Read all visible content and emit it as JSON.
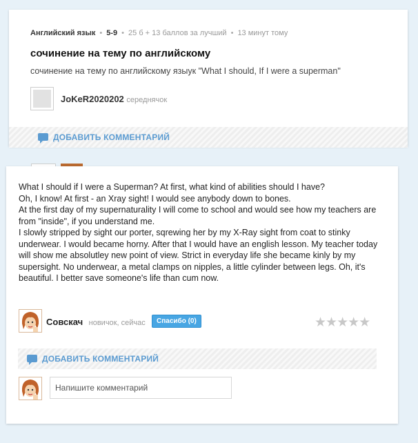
{
  "question": {
    "subject": "Английский язык",
    "grade": "5-9",
    "points": "25 б + 13 баллов за лучший",
    "time": "13 минут тому",
    "title": "сочинение на тему по английскому",
    "text": "сочинение на тему по английскому языук \"What I should, If I were a superman\"",
    "author": "JoKeR2020202",
    "author_rank": "середнячок",
    "add_comment": "ДОБАВИТЬ КОММЕНТАРИЙ"
  },
  "answer": {
    "paragraphs": [
      "What I should if I were a Superman? At first, what kind of abilities should I have?",
      "Oh, I know! At first - an Xray sight! I would see anybody down to bones.",
      "At the first day of my supernaturality I will come to school and would see how my teachers are from \"inside\", if you understand me.",
      "I slowly stripped by sight our porter, sqrewing her by my X-Ray sight from coat to stinky underwear. I would became horny. After that I would have an english lesson. My teacher today will show me absolutley new point of view. Strict in everyday life she became kinly by my supersight. No underwear, a metal clamps on nipples, a little cylinder between legs. Oh, it's beautiful. I better save someone's life than cum now."
    ],
    "author": "Совскач",
    "author_meta": "новичок, сейчас",
    "thanks_label": "Спасибо (0)",
    "stars": "★★★★★",
    "add_comment": "ДОБАВИТЬ КОММЕНТАРИЙ",
    "comment_placeholder": "Напишите комментарий"
  },
  "colors": {
    "background": "#e7f1f8",
    "link_blue": "#5b9bd1",
    "thanks_button": "#48a6e3",
    "star_empty": "#c8c8c8"
  },
  "icons": [
    "comment-bubble-icon",
    "avatar-placeholder-icon",
    "user-face-icon",
    "star-icon"
  ]
}
